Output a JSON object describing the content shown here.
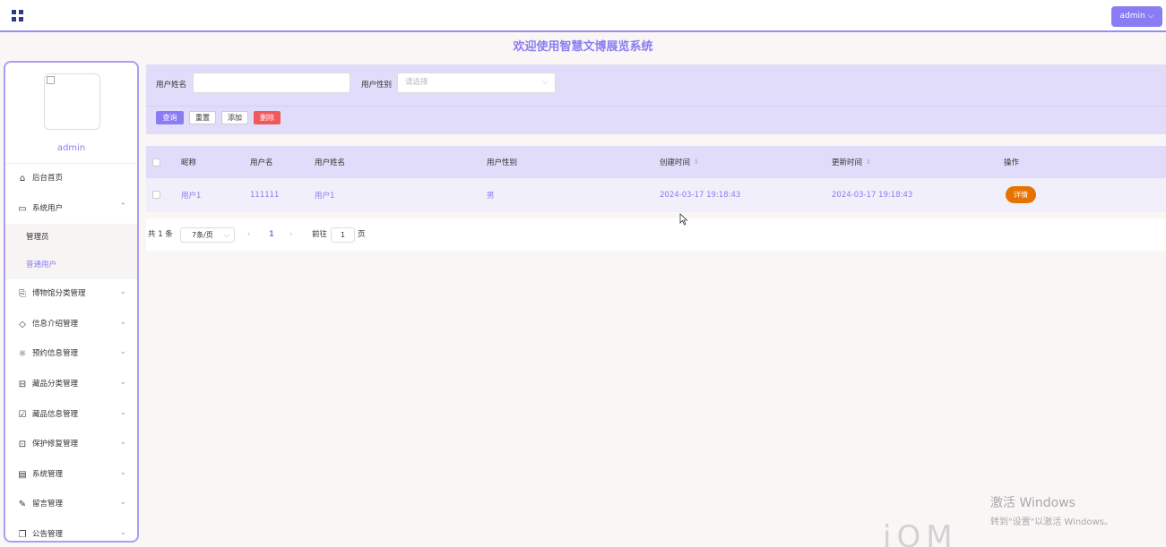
{
  "header": {
    "admin_button": "admin ⌵"
  },
  "welcome_title": "欢迎使用智慧文博展览系统",
  "sidebar": {
    "username": "admin",
    "items": [
      {
        "label": "后台首页",
        "icon": "home-icon",
        "glyph": "⌂",
        "has_chevron": false
      },
      {
        "label": "系统用户",
        "icon": "monitor-icon",
        "glyph": "▭",
        "has_chevron": true,
        "expanded": true,
        "children": [
          {
            "label": "管理员",
            "active": false
          },
          {
            "label": "普通用户",
            "active": true
          }
        ]
      },
      {
        "label": "博物馆分类管理",
        "icon": "bookmark-icon",
        "glyph": "⎘",
        "has_chevron": true
      },
      {
        "label": "信息介绍管理",
        "icon": "tag-icon",
        "glyph": "◇",
        "has_chevron": true
      },
      {
        "label": "预约信息管理",
        "icon": "sun-icon",
        "glyph": "☼",
        "has_chevron": true
      },
      {
        "label": "藏品分类管理",
        "icon": "inbox-icon",
        "glyph": "⊟",
        "has_chevron": true
      },
      {
        "label": "藏品信息管理",
        "icon": "clipboard-icon",
        "glyph": "☑",
        "has_chevron": true
      },
      {
        "label": "保护修复管理",
        "icon": "chat-icon",
        "glyph": "⊡",
        "has_chevron": true
      },
      {
        "label": "系统管理",
        "icon": "box-icon",
        "glyph": "▤",
        "has_chevron": true
      },
      {
        "label": "留言管理",
        "icon": "paperclip-icon",
        "glyph": "✎",
        "has_chevron": true
      },
      {
        "label": "公告管理",
        "icon": "copy-icon",
        "glyph": "❐",
        "has_chevron": true
      }
    ]
  },
  "search": {
    "name_label": "用户姓名",
    "name_value": "",
    "gender_label": "用户性别",
    "gender_placeholder": "请选择",
    "buttons": {
      "query": "查询",
      "reset": "重置",
      "add": "添加",
      "delete": "删除"
    }
  },
  "table": {
    "columns": [
      "昵称",
      "用户名",
      "用户姓名",
      "用户性别",
      "创建时间",
      "更新时间",
      "操作"
    ],
    "rows": [
      {
        "nickname": "用户1",
        "username": "111111",
        "realname": "用户1",
        "gender": "男",
        "created": "2024-03-17 19:18:43",
        "updated": "2024-03-17 19:18:43",
        "action": "详情"
      }
    ]
  },
  "pagination": {
    "total": "共 1 条",
    "page_size": "7条/页",
    "prev": "‹",
    "current": "1",
    "next": "›",
    "goto_label": "前往",
    "goto_value": "1",
    "page_suffix": "页"
  },
  "watermark": {
    "line1": "激活 Windows",
    "line2": "转到\"设置\"以激活 Windows。"
  },
  "edge_text": "iOM"
}
